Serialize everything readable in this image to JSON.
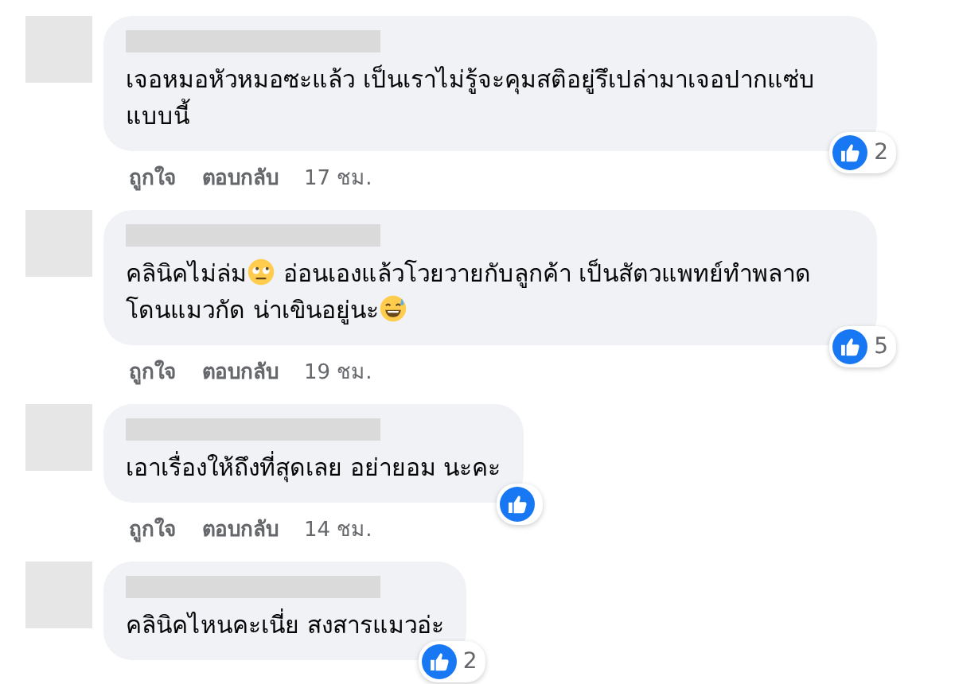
{
  "comments": [
    {
      "text": [
        {
          "kind": "text",
          "text": "เจอหมอหัวหมอซะแล้ว เป็นเราไม่รู้จะคุมสติอยู่รึเปล่ามาเจอปากแซ่บแบบนี้"
        }
      ],
      "reactions": "2",
      "actions": {
        "like": "ถูกใจ",
        "reply": "ตอบกลับ",
        "time": "17 ชม."
      }
    },
    {
      "text": [
        {
          "kind": "text",
          "text": "คลินิคไม่ล่ม"
        },
        {
          "kind": "rolleyes"
        },
        {
          "kind": "text",
          "text": " อ่อนเองแล้วโวยวายกับลูกค้า เป็นสัตวแพทย์ทำพลาดโดนแมวกัด น่าเขินอยู่นะ"
        },
        {
          "kind": "sweatsmile"
        }
      ],
      "reactions": "5",
      "actions": {
        "like": "ถูกใจ",
        "reply": "ตอบกลับ",
        "time": "19 ชม."
      }
    },
    {
      "text": [
        {
          "kind": "text",
          "text": "เอาเรื่องให้ถึงที่สุดเลย อย่ายอม นะคะ"
        }
      ],
      "reactions_shown": true,
      "actions": {
        "like": "ถูกใจ",
        "reply": "ตอบกลับ",
        "time": "14 ชม."
      }
    },
    {
      "text": [
        {
          "kind": "text",
          "text": "คลินิคไหนคะเนี่ย สงสารแมวอ่ะ"
        }
      ],
      "reactions": "2"
    }
  ]
}
